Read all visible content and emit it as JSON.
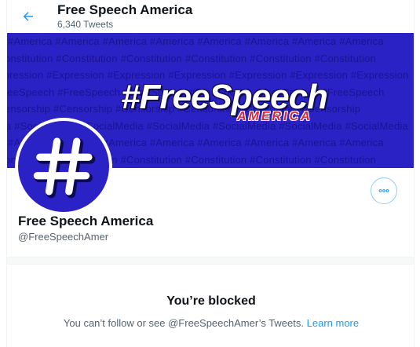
{
  "header": {
    "title": "Free Speech America",
    "tweet_count": "6,340 Tweets"
  },
  "banner": {
    "headline": "#FreeSpeech",
    "subline": "AMERICA",
    "pattern_rows": [
      "ica #America #America #America #America #America #America #America #America",
      "#Constitution #Constitution #Constitution #Constitution #Constitution #Constitution",
      "Expression #Expression #Expression #Expression #Expression #Expression #Expression",
      "#FreeSpeech #FreeSpeech #FreeSpeech #FreeSpeech #FreeSpeech #FreeSpeech",
      "#Censorship #Censorship #Censorship #Censorship #Censorship #Censorship",
      "edia #SocialMedia #SocialMedia #SocialMedia #SocialMedia #SocialMedia #SocialMedia",
      "ica #America #America #America #America #America #America #America #America",
      "#Constitution #Constitution #Constitution #Constitution #Constitution #Constitution"
    ]
  },
  "profile": {
    "name": "Free Speech America",
    "handle": "@FreeSpeechAmer"
  },
  "blocked": {
    "title": "You’re blocked",
    "message": "You can’t follow or see @FreeSpeechAmer’s Tweets.",
    "link_label": "Learn more"
  },
  "colors": {
    "brand_blue": "#2b22c6",
    "accent": "#1d9bf0",
    "america_red": "#d6283a"
  },
  "icons": {
    "back": "arrow-left-icon",
    "more": "more-horizontal-icon",
    "avatar": "hashtag-icon"
  }
}
